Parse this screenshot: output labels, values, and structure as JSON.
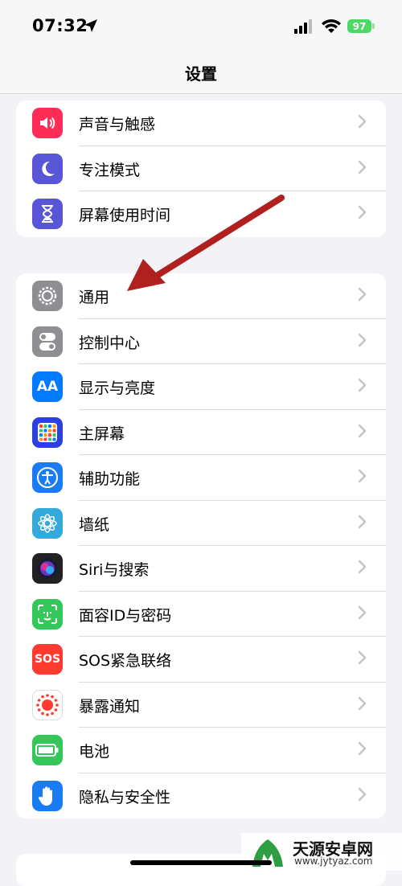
{
  "status": {
    "time": "07:32",
    "battery": "97"
  },
  "nav": {
    "title": "设置"
  },
  "group1": [
    {
      "label": "声音与触感",
      "icon": "speaker-icon",
      "color": "#ff2d55"
    },
    {
      "label": "专注模式",
      "icon": "moon-icon",
      "color": "#5856d6"
    },
    {
      "label": "屏幕使用时间",
      "icon": "hourglass-icon",
      "color": "#5856d6"
    }
  ],
  "group2": [
    {
      "label": "通用",
      "icon": "gear-icon",
      "color": "#8e8e93"
    },
    {
      "label": "控制中心",
      "icon": "toggle-icon",
      "color": "#8e8e93"
    },
    {
      "label": "显示与亮度",
      "icon": "aa-icon",
      "color": "#007aff",
      "glyph": "AA"
    },
    {
      "label": "主屏幕",
      "icon": "home-grid-icon",
      "color": "#2c3fe0"
    },
    {
      "label": "辅助功能",
      "icon": "accessibility-icon",
      "color": "#1a7cf5"
    },
    {
      "label": "墙纸",
      "icon": "flower-icon",
      "color": "#34aadc"
    },
    {
      "label": "Siri与搜索",
      "icon": "siri-icon",
      "color": "#222222"
    },
    {
      "label": "面容ID与密码",
      "icon": "faceid-icon",
      "color": "#34c759"
    },
    {
      "label": "SOS紧急联络",
      "icon": "sos-icon",
      "color": "#ff3b30",
      "glyph": "SOS"
    },
    {
      "label": "暴露通知",
      "icon": "exposure-icon",
      "color": "#ffffff"
    },
    {
      "label": "电池",
      "icon": "battery-icon",
      "color": "#34c759"
    },
    {
      "label": "隐私与安全性",
      "icon": "hand-icon",
      "color": "#1a7cf5"
    }
  ],
  "watermark": {
    "text": "天源安卓网",
    "url": "www.jytyaz.com"
  },
  "colors": {
    "arrow": "#b0201e",
    "chevron": "#c4c4c7"
  }
}
